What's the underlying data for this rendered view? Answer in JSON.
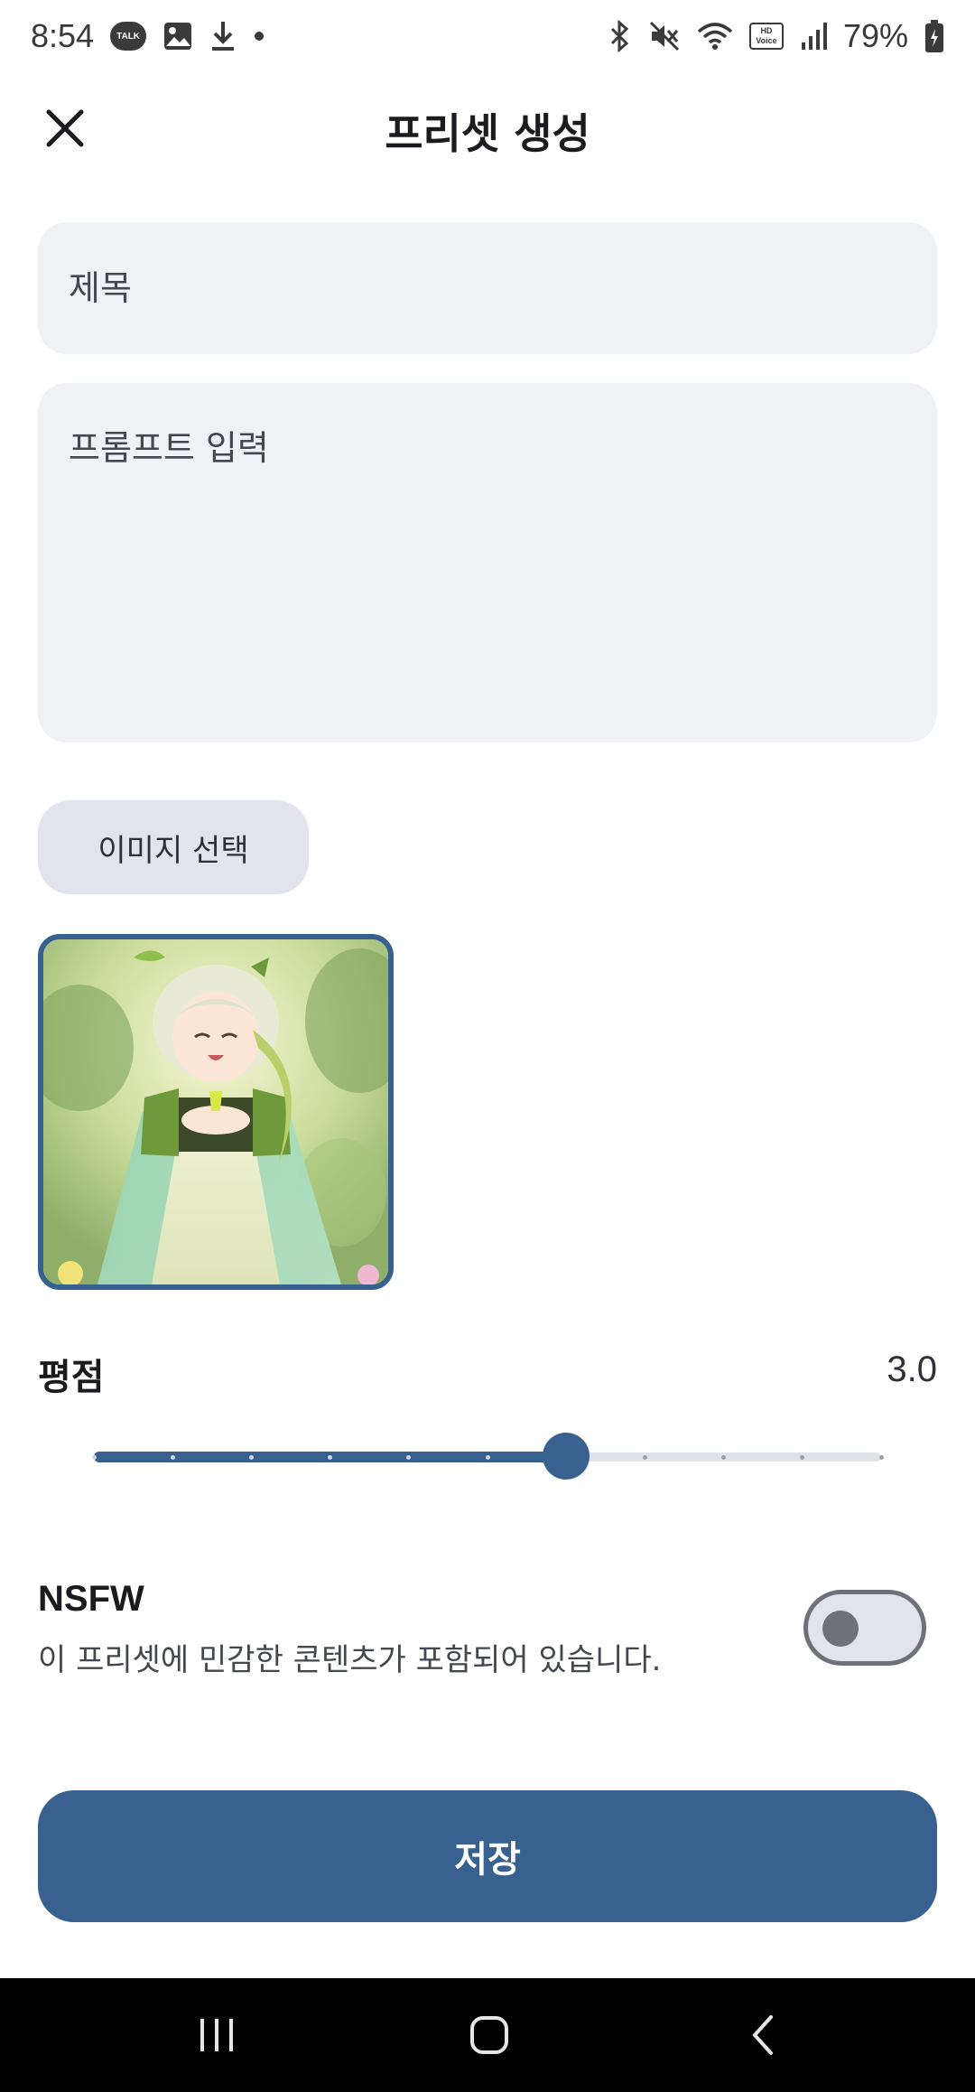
{
  "status_bar": {
    "time": "8:54",
    "talk_badge": "TALK",
    "hd_badge": "HD Voice",
    "battery_percent": "79%",
    "icons": [
      "kakaotalk-icon",
      "gallery-icon",
      "download-icon",
      "dot-icon",
      "bluetooth-icon",
      "mute-icon",
      "wifi-icon",
      "hd-voice-icon",
      "signal-icon",
      "battery-icon"
    ]
  },
  "app_bar": {
    "title": "프리셋 생성",
    "close_icon": "close-icon"
  },
  "form": {
    "title_placeholder": "제목",
    "title_value": "",
    "prompt_placeholder": "프롬프트 입력",
    "prompt_value": "",
    "image_select_label": "이미지 선택"
  },
  "rating": {
    "label": "평점",
    "value_text": "3.0",
    "value": 3.0,
    "min": 0,
    "max": 5,
    "step": 0.5
  },
  "nsfw": {
    "title": "NSFW",
    "description": "이 프리셋에 민감한 콘텐츠가 포함되어 있습니다.",
    "enabled": false
  },
  "save_label": "저장",
  "colors": {
    "primary": "#38618f",
    "field_bg": "#eff1f5",
    "tonal_button": "#e2e3ec",
    "inactive_track": "#e1e2e8"
  }
}
